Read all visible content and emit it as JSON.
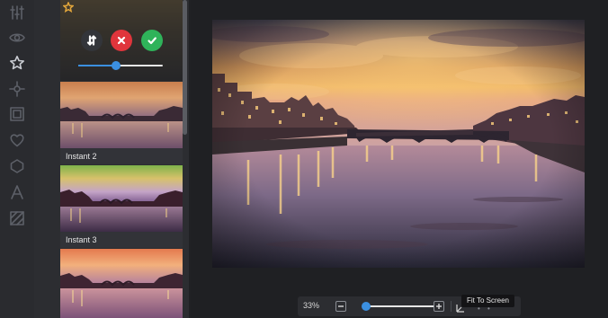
{
  "rail": {
    "tools": [
      {
        "name": "adjust-sliders-icon",
        "active": false
      },
      {
        "name": "eye-icon",
        "active": false
      },
      {
        "name": "star-icon",
        "active": true
      },
      {
        "name": "focus-icon",
        "active": false
      },
      {
        "name": "frame-icon",
        "active": false
      },
      {
        "name": "heart-icon",
        "active": false
      },
      {
        "name": "shape-icon",
        "active": false
      },
      {
        "name": "text-icon",
        "active": false
      },
      {
        "name": "texture-icon",
        "active": false
      }
    ]
  },
  "filters": {
    "active_card": {
      "favorite_icon": "star-icon",
      "buttons": [
        {
          "name": "compare-button",
          "icon": "arrows-icon",
          "color": "#33353a"
        },
        {
          "name": "cancel-button",
          "icon": "close-icon",
          "color": "#e0353c"
        },
        {
          "name": "apply-button",
          "icon": "check-icon",
          "color": "#2fb35a"
        }
      ],
      "intensity": 0.45
    },
    "items": [
      {
        "label": "Instant 2"
      },
      {
        "label": "Instant 3"
      },
      {
        "label": ""
      }
    ]
  },
  "zoom": {
    "value": "33%",
    "level": 0.05,
    "fit_tooltip": "Fit To Screen"
  },
  "colors": {
    "accent": "#3b8fe0",
    "cancel": "#e0353c",
    "confirm": "#2fb35a",
    "favorite": "#e2a63b"
  }
}
